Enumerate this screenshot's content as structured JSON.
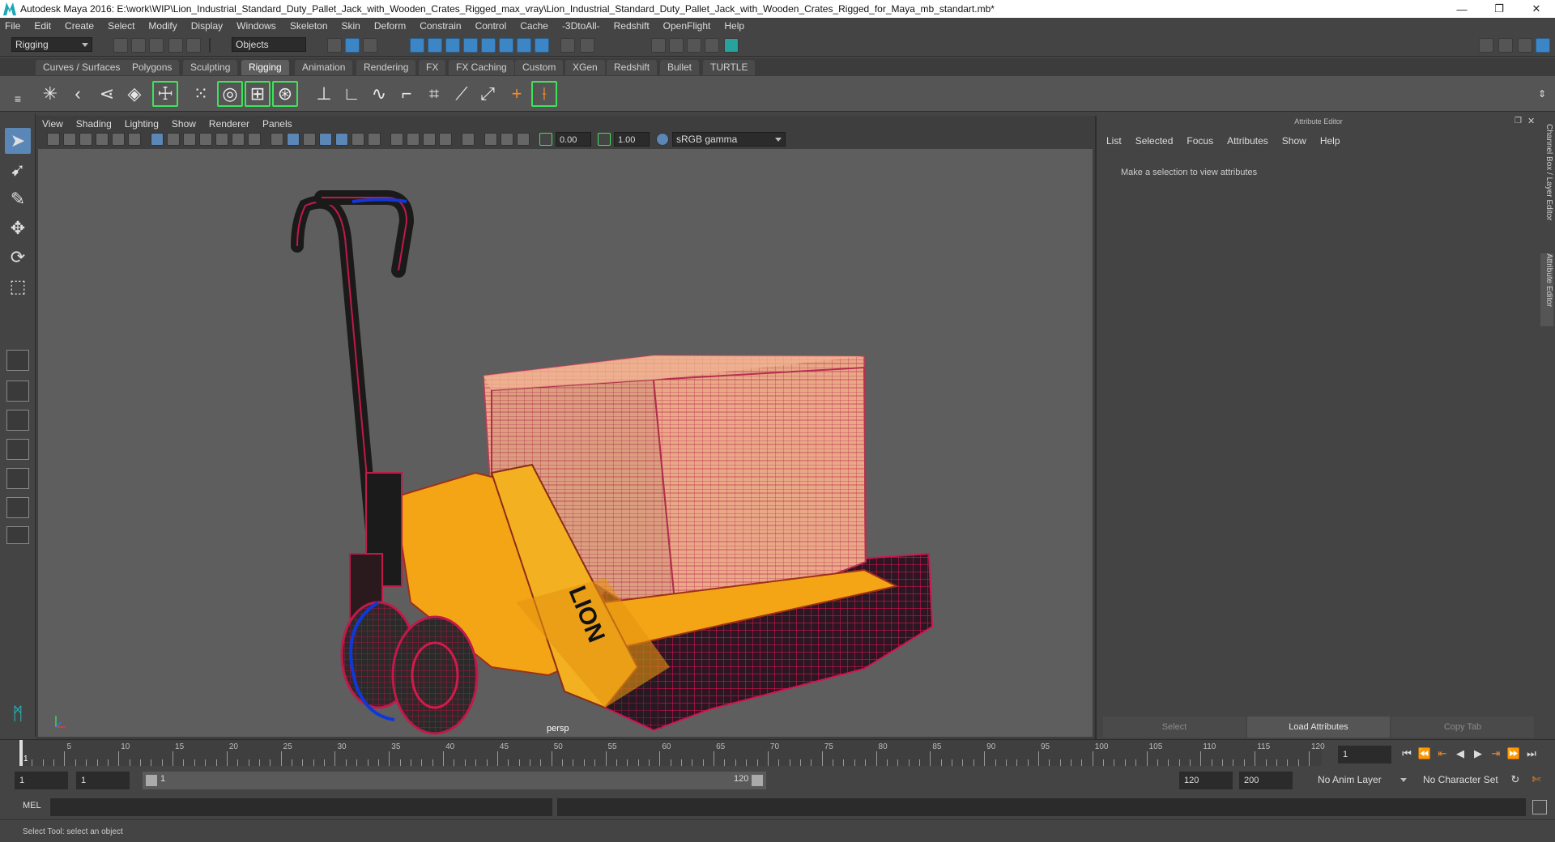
{
  "window": {
    "title": "Autodesk Maya 2016: E:\\work\\WIP\\Lion_Industrial_Standard_Duty_Pallet_Jack_with_Wooden_Crates_Rigged_max_vray\\Lion_Industrial_Standard_Duty_Pallet_Jack_with_Wooden_Crates_Rigged_for_Maya_mb_standart.mb*",
    "minimize": "—",
    "restore": "❐",
    "close": "✕"
  },
  "menubar": [
    "File",
    "Edit",
    "Create",
    "Select",
    "Modify",
    "Display",
    "Windows",
    "Skeleton",
    "Skin",
    "Deform",
    "Constrain",
    "Control",
    "Cache",
    "-3DtoAll-",
    "Redshift",
    "OpenFlight",
    "Help"
  ],
  "statusline": {
    "mode": "Rigging",
    "selection_mask": "Objects"
  },
  "shelf_tabs": [
    {
      "label": "Curves / Surfaces",
      "active": false
    },
    {
      "label": "Polygons",
      "active": false
    },
    {
      "label": "Sculpting",
      "active": false
    },
    {
      "label": "Rigging",
      "active": true
    },
    {
      "label": "Animation",
      "active": false
    },
    {
      "label": "Rendering",
      "active": false
    },
    {
      "label": "FX",
      "active": false
    },
    {
      "label": "FX Caching",
      "active": false
    },
    {
      "label": "Custom",
      "active": false
    },
    {
      "label": "XGen",
      "active": false
    },
    {
      "label": "Redshift",
      "active": false
    },
    {
      "label": "Bullet",
      "active": false
    },
    {
      "label": "TURTLE",
      "active": false
    }
  ],
  "viewport": {
    "menu": [
      "View",
      "Shading",
      "Lighting",
      "Show",
      "Renderer",
      "Panels"
    ],
    "exposure": "0.00",
    "gamma": "1.00",
    "color_space": "sRGB gamma",
    "camera": "persp",
    "model_text": "LION"
  },
  "attribute_editor": {
    "header": "Attribute Editor",
    "menu": [
      "List",
      "Selected",
      "Focus",
      "Attributes",
      "Show",
      "Help"
    ],
    "message": "Make a selection to view attributes",
    "buttons": {
      "select": "Select",
      "load": "Load Attributes",
      "copy": "Copy Tab"
    }
  },
  "side_tabs": {
    "channel_box": "Channel Box / Layer Editor",
    "attribute_editor": "Attribute Editor"
  },
  "timeline": {
    "ticks": [
      "1",
      "5",
      "10",
      "15",
      "20",
      "25",
      "30",
      "35",
      "40",
      "45",
      "50",
      "55",
      "60",
      "65",
      "70",
      "75",
      "80",
      "85",
      "90",
      "95",
      "100",
      "105",
      "110",
      "115",
      "120"
    ],
    "current_frame": "1"
  },
  "range": {
    "start": "1",
    "playback_start": "1",
    "slider_start": "1",
    "slider_end": "120",
    "playback_end": "120",
    "end": "200",
    "anim_layer": "No Anim Layer",
    "character_set": "No Character Set"
  },
  "cmdline": {
    "label": "MEL"
  },
  "helpline": {
    "text": "Select Tool: select an object"
  }
}
